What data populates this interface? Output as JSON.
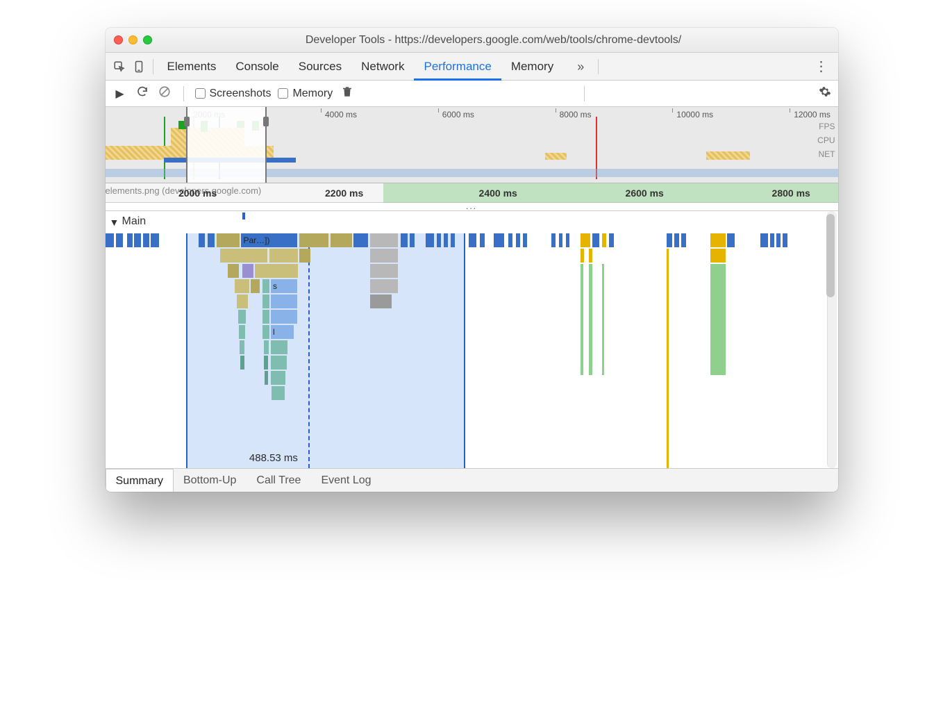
{
  "window": {
    "title": "Developer Tools - https://developers.google.com/web/tools/chrome-devtools/"
  },
  "tabs": {
    "items": [
      "Elements",
      "Console",
      "Sources",
      "Network",
      "Performance",
      "Memory"
    ],
    "active_index": 4,
    "overflow": "»",
    "menu_glyph": "⋮"
  },
  "controls": {
    "record_glyph": "▶",
    "reload_glyph": "↻",
    "clear_glyph": "⊘",
    "screenshots_label": "Screenshots",
    "memory_label": "Memory",
    "trash_glyph": "🗑",
    "gear_glyph": "⚙"
  },
  "overview": {
    "ticks": [
      {
        "label": "2000 ms",
        "pct": 12
      },
      {
        "label": "4000 ms",
        "pct": 30
      },
      {
        "label": "6000 ms",
        "pct": 46
      },
      {
        "label": "8000 ms",
        "pct": 62
      },
      {
        "label": "10000 ms",
        "pct": 78
      },
      {
        "label": "12000 ms",
        "pct": 94
      }
    ],
    "lane_labels": [
      "FPS",
      "CPU",
      "NET"
    ],
    "selection": {
      "left_pct": 11,
      "right_pct": 22
    },
    "markers": {
      "red_pct": 67,
      "blue_pct": 15.5,
      "green_pct": 8,
      "orange_pct": 12
    }
  },
  "ruler2": {
    "file_label": "elements.png (developers.google.com)",
    "ticks": [
      {
        "label": "2000 ms",
        "pct": 10
      },
      {
        "label": "2200 ms",
        "pct": 30
      },
      {
        "label": "2400 ms",
        "pct": 51
      },
      {
        "label": "2600 ms",
        "pct": 71
      },
      {
        "label": "2800 ms",
        "pct": 91
      }
    ]
  },
  "ellipsis": "...",
  "main": {
    "caret": "▼",
    "label": "Main",
    "selection": {
      "left_pct": 11.2,
      "right_pct": 50,
      "dashed_pct": 28.2,
      "marker_pct": 19
    },
    "duration_label": "488.53 ms",
    "parse_label": "Par…])",
    "s_label": "s",
    "l_label": "l"
  },
  "bottom_tabs": {
    "items": [
      "Summary",
      "Bottom-Up",
      "Call Tree",
      "Event Log"
    ],
    "active_index": 0
  }
}
